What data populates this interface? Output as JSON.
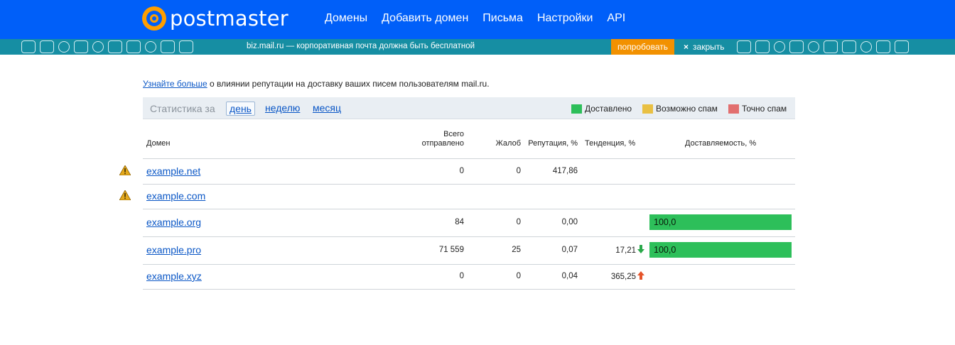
{
  "header": {
    "logo_text": "postmaster",
    "nav": [
      "Домены",
      "Добавить домен",
      "Письма",
      "Настройки",
      "API"
    ]
  },
  "promo": {
    "text": "biz.mail.ru — корпоративная почта должна быть бесплатной",
    "try_label": "попробовать",
    "close_icon": "×",
    "close_label": "закрыть"
  },
  "info": {
    "link_text": "Узнайте больше",
    "text": " о влиянии репутации на доставку ваших писем пользователям mail.ru."
  },
  "stats": {
    "label": "Статистика за",
    "periods": [
      "день",
      "неделю",
      "месяц"
    ],
    "active_period": "день"
  },
  "legend": [
    {
      "label": "Доставлено",
      "color": "#2dbf5a"
    },
    {
      "label": "Возможно спам",
      "color": "#e9c043"
    },
    {
      "label": "Точно спам",
      "color": "#e26f6f"
    }
  ],
  "table": {
    "headers": {
      "domain": "Домен",
      "sent_line1": "Всего",
      "sent_line2": "отправлено",
      "complaints": "Жалоб",
      "reputation": "Репутация, %",
      "trend": "Тенденция, %",
      "deliverability": "Доставляемость, %"
    },
    "rows": [
      {
        "domain": "example.net",
        "warning": true,
        "sent": "0",
        "complaints": "0",
        "reputation": "417,86",
        "trend": "",
        "trend_dir": "",
        "delivered": ""
      },
      {
        "domain": "example.com",
        "warning": true,
        "sent": "",
        "complaints": "",
        "reputation": "",
        "trend": "",
        "trend_dir": "",
        "delivered": ""
      },
      {
        "domain": "example.org",
        "warning": false,
        "sent": "84",
        "complaints": "0",
        "reputation": "0,00",
        "trend": "",
        "trend_dir": "",
        "delivered": "100,0"
      },
      {
        "domain": "example.pro",
        "warning": false,
        "sent": "71 559",
        "complaints": "25",
        "reputation": "0,07",
        "trend": "17,21",
        "trend_dir": "down",
        "delivered": "100,0"
      },
      {
        "domain": "example.xyz",
        "warning": false,
        "sent": "0",
        "complaints": "0",
        "reputation": "0,04",
        "trend": "365,25",
        "trend_dir": "up",
        "delivered": ""
      }
    ]
  },
  "colors": {
    "header_bg": "#005ff9",
    "logo_accent": "#ff9e00",
    "promo_bg": "#168ea3",
    "promo_button": "#f29100",
    "link": "#0b57c6",
    "trend_down": "#2aa84a",
    "trend_up": "#e5542a"
  },
  "icons": {
    "warning": "warning-triangle-icon",
    "trend_down": "arrow-down-icon",
    "trend_up": "arrow-up-icon"
  }
}
